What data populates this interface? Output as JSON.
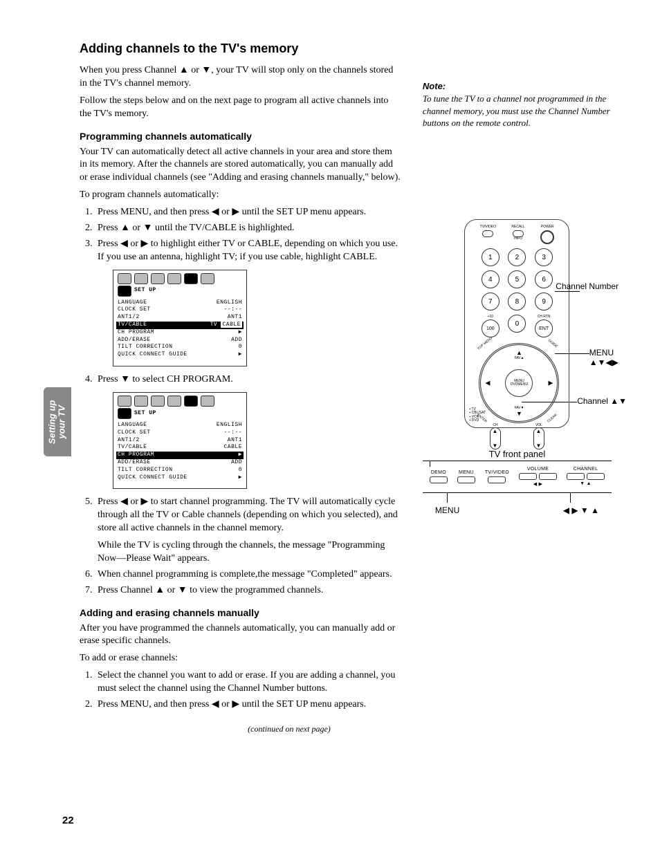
{
  "pageNumber": "22",
  "sideTab": {
    "line1": "Setting up",
    "line2": "your TV"
  },
  "h1": "Adding channels to the TV's memory",
  "intro1a": "When you press Channel ",
  "intro1b": " or ",
  "intro1c": ", your TV will stop only on the channels stored in the TV's channel memory.",
  "intro2": "Follow the steps below and on the next page to program all active channels into the TV's memory.",
  "h2a": "Programming channels automatically",
  "auto1": "Your TV can automatically detect all active channels in your area and store them in its memory. After the channels are stored automatically, you can manually add or erase individual channels (see \"Adding and erasing channels manually,\" below).",
  "auto2": "To program channels automatically:",
  "steps1": {
    "s1a": "Press MENU, and then press ",
    "s1b": " or ",
    "s1c": " until the SET UP menu appears.",
    "s2a": "Press ",
    "s2b": " or ",
    "s2c": " until the TV/CABLE is highlighted.",
    "s3a": "Press ",
    "s3b": " or ",
    "s3c": " to highlight either TV or CABLE, depending on which you use. If you use an antenna, highlight TV; if you use cable, highlight CABLE.",
    "s4a": "Press ",
    "s4b": " to select CH PROGRAM.",
    "s5a": "Press ",
    "s5b": " or ",
    "s5c": " to start channel programming. The TV will automatically cycle through all the TV or Cable channels (depending on which you selected), and store all active channels in the channel memory.",
    "s5d": "While the TV is cycling through the channels, the message \"Programming Now—Please Wait\" appears.",
    "s6": "When channel programming is complete,the message \"Completed\" appears.",
    "s7a": "Press Channel ",
    "s7b": " or ",
    "s7c": " to view the programmed channels."
  },
  "h2b": "Adding and erasing channels manually",
  "man1": "After you have programmed the channels automatically, you can manually add or erase specific channels.",
  "man2": "To add or erase channels:",
  "steps2": {
    "s1": "Select the channel you want to add or erase. If you are adding a channel, you must select the channel using the Channel Number buttons.",
    "s2a": "Press MENU, and then press ",
    "s2b": " or ",
    "s2c": " until the SET UP menu appears."
  },
  "continued": "(continued on next page)",
  "note": {
    "heading": "Note:",
    "body": "To tune the TV to a channel not programmed in the channel memory, you must use the Channel Number buttons on the remote control."
  },
  "osd": {
    "title": "SET UP",
    "rows": [
      {
        "l": "LANGUAGE",
        "r": "ENGLISH"
      },
      {
        "l": "CLOCK SET",
        "r": "--:--"
      },
      {
        "l": "ANT1/2",
        "r": "ANT1"
      },
      {
        "l": "TV/CABLE",
        "r": "CABLE"
      },
      {
        "l": "CH PROGRAM",
        "r": "▶"
      },
      {
        "l": "ADD/ERASE",
        "r": "ADD"
      },
      {
        "l": "TILT CORRECTION",
        "r": "0"
      },
      {
        "l": "QUICK CONNECT GUIDE",
        "r": "▶"
      }
    ],
    "tvLabel": "TV"
  },
  "remote": {
    "top": {
      "tvvideo": "TV/VIDEO",
      "recall": "RECALL",
      "info": "INFO",
      "power": "POWER"
    },
    "nums": [
      "1",
      "2",
      "3",
      "4",
      "5",
      "6",
      "7",
      "8",
      "9",
      "100",
      "0",
      "ENT"
    ],
    "plus10": "+10",
    "chrtn": "CH RTN",
    "center": "MENU DVDMENU",
    "fav": "FAV",
    "corners": {
      "tl": "TOP MENU",
      "tr": "GUIDE",
      "bl": "ENTER",
      "br": "CLEAR"
    },
    "bottom": {
      "ch": "CH",
      "vol": "VOL"
    },
    "switch": [
      "TV",
      "CBL/SAT",
      "VCR",
      "DVD"
    ]
  },
  "callouts": {
    "chnum": "Channel Number",
    "menu": "MENU",
    "arrows": "▲▼◀▶",
    "chupdown": "Channel ▲▼"
  },
  "panel": {
    "title": "TV front panel",
    "labels": {
      "demo": "DEMO",
      "menu": "MENU",
      "tvvideo": "TV/VIDEO",
      "volume": "VOLUME",
      "channel": "CHANNEL"
    },
    "vol": "◀  ▶",
    "ch": "▼  ▲",
    "bottom": {
      "menu": "MENU",
      "arr": "◀ ▶ ▼ ▲"
    }
  }
}
